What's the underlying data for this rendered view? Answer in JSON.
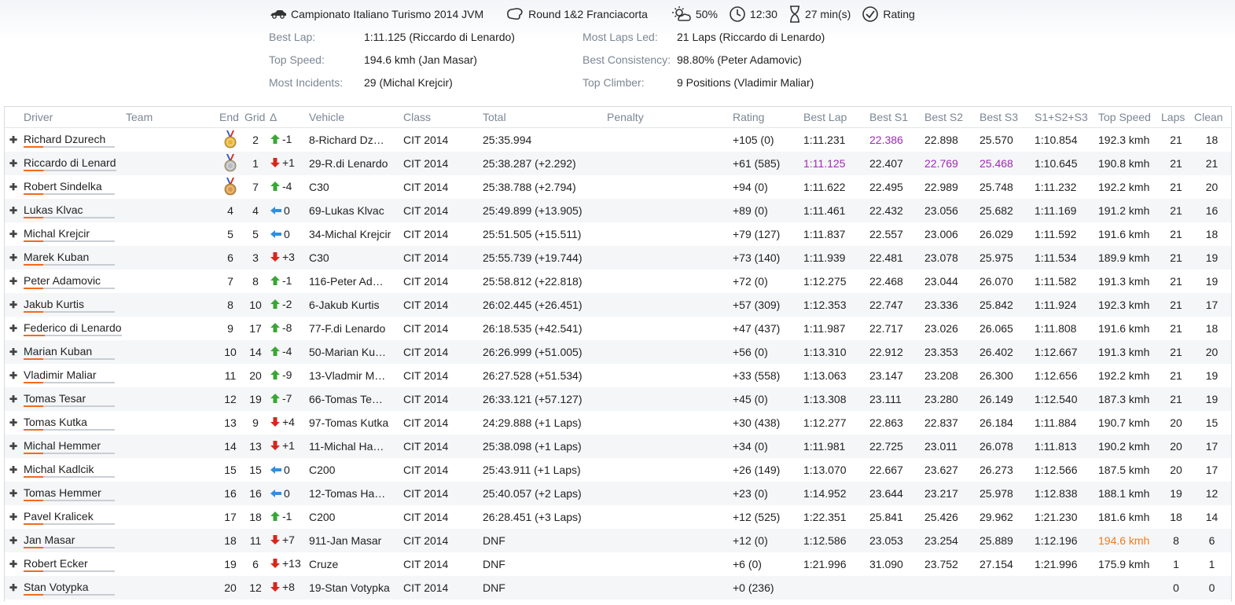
{
  "session": {
    "championship": "Campionato Italiano Turismo 2014 JVM",
    "round": "Round 1&2 Franciacorta",
    "weather": "50%",
    "time": "12:30",
    "duration": "27 min(s)",
    "rating": "Rating"
  },
  "stats": {
    "best_lap_label": "Best Lap:",
    "best_lap": "1:11.125 (Riccardo di Lenardo)",
    "top_speed_label": "Top Speed:",
    "top_speed": "194.6 kmh (Jan Masar)",
    "most_incidents_label": "Most Incidents:",
    "most_incidents": "29 (Michal Krejcir)",
    "most_laps_led_label": "Most Laps Led:",
    "most_laps_led": "21 Laps (Riccardo di Lenardo)",
    "best_consistency_label": "Best Consistency:",
    "best_consistency": "98.80% (Peter Adamovic)",
    "top_climber_label": "Top Climber:",
    "top_climber": "9 Positions (Vladimir Maliar)"
  },
  "columns": [
    "Driver",
    "Team",
    "End",
    "Grid",
    "Δ",
    "Vehicle",
    "Class",
    "Total",
    "Penalty",
    "Rating",
    "Best Lap",
    "Best S1",
    "Best S2",
    "Best S3",
    "S1+S2+S3",
    "Top Speed",
    "Laps",
    "Clean"
  ],
  "colors": {
    "purple": "#a02ab5",
    "orange": "#f07a1a",
    "up": "#3aa635",
    "down": "#d9261c",
    "same": "#2f8fe0"
  },
  "rows": [
    {
      "driver": "Richard Dzurech",
      "team": "",
      "end": "1",
      "medal": "gold",
      "grid": "2",
      "dir": "up",
      "delta": "-1",
      "vehicle": "8-Richard Dz…",
      "class": "CIT 2014",
      "total": "25:35.994",
      "penalty": "",
      "rating": "+105 (0)",
      "best_lap": "1:11.231",
      "s1": "22.386",
      "s2": "22.898",
      "s3": "25.570",
      "sum": "1:10.854",
      "speed": "192.3 kmh",
      "laps": "21",
      "clean": "18",
      "hl": {
        "s1": "purple"
      }
    },
    {
      "driver": "Riccardo di Lenard",
      "team": "",
      "end": "2",
      "medal": "silver",
      "grid": "1",
      "dir": "down",
      "delta": "+1",
      "vehicle": "29-R.di Lenardo",
      "class": "CIT 2014",
      "total": "25:38.287 (+2.292)",
      "penalty": "",
      "rating": "+61 (585)",
      "best_lap": "1:11.125",
      "s1": "22.407",
      "s2": "22.769",
      "s3": "25.468",
      "sum": "1:10.645",
      "speed": "190.8 kmh",
      "laps": "21",
      "clean": "21",
      "hl": {
        "best_lap": "purple",
        "s2": "purple",
        "s3": "purple"
      }
    },
    {
      "driver": "Robert Sindelka",
      "team": "",
      "end": "3",
      "medal": "bronze",
      "grid": "7",
      "dir": "up",
      "delta": "-4",
      "vehicle": "C30",
      "class": "CIT 2014",
      "total": "25:38.788 (+2.794)",
      "penalty": "",
      "rating": "+94 (0)",
      "best_lap": "1:11.622",
      "s1": "22.495",
      "s2": "22.989",
      "s3": "25.748",
      "sum": "1:11.232",
      "speed": "192.2 kmh",
      "laps": "21",
      "clean": "20",
      "hl": {}
    },
    {
      "driver": "Lukas Klvac",
      "team": "",
      "end": "4",
      "medal": "",
      "grid": "4",
      "dir": "same",
      "delta": "0",
      "vehicle": "69-Lukas Klvac",
      "class": "CIT 2014",
      "total": "25:49.899 (+13.905)",
      "penalty": "",
      "rating": "+89 (0)",
      "best_lap": "1:11.461",
      "s1": "22.432",
      "s2": "23.056",
      "s3": "25.682",
      "sum": "1:11.169",
      "speed": "191.2 kmh",
      "laps": "21",
      "clean": "16",
      "hl": {}
    },
    {
      "driver": "Michal Krejcir",
      "team": "",
      "end": "5",
      "medal": "",
      "grid": "5",
      "dir": "same",
      "delta": "0",
      "vehicle": "34-Michal Krejcir",
      "class": "CIT 2014",
      "total": "25:51.505 (+15.511)",
      "penalty": "",
      "rating": "+79 (127)",
      "best_lap": "1:11.837",
      "s1": "22.557",
      "s2": "23.006",
      "s3": "26.029",
      "sum": "1:11.592",
      "speed": "191.6 kmh",
      "laps": "21",
      "clean": "18",
      "hl": {}
    },
    {
      "driver": "Marek Kuban",
      "team": "",
      "end": "6",
      "medal": "",
      "grid": "3",
      "dir": "down",
      "delta": "+3",
      "vehicle": "C30",
      "class": "CIT 2014",
      "total": "25:55.739 (+19.744)",
      "penalty": "",
      "rating": "+73 (140)",
      "best_lap": "1:11.939",
      "s1": "22.481",
      "s2": "23.078",
      "s3": "25.975",
      "sum": "1:11.534",
      "speed": "189.9 kmh",
      "laps": "21",
      "clean": "19",
      "hl": {}
    },
    {
      "driver": "Peter Adamovic",
      "team": "",
      "end": "7",
      "medal": "",
      "grid": "8",
      "dir": "up",
      "delta": "-1",
      "vehicle": "116-Peter Ad…",
      "class": "CIT 2014",
      "total": "25:58.812 (+22.818)",
      "penalty": "",
      "rating": "+72 (0)",
      "best_lap": "1:12.275",
      "s1": "22.468",
      "s2": "23.044",
      "s3": "26.070",
      "sum": "1:11.582",
      "speed": "191.3 kmh",
      "laps": "21",
      "clean": "19",
      "hl": {}
    },
    {
      "driver": "Jakub Kurtis",
      "team": "",
      "end": "8",
      "medal": "",
      "grid": "10",
      "dir": "up",
      "delta": "-2",
      "vehicle": "6-Jakub Kurtis",
      "class": "CIT 2014",
      "total": "26:02.445 (+26.451)",
      "penalty": "",
      "rating": "+57 (309)",
      "best_lap": "1:12.353",
      "s1": "22.747",
      "s2": "23.336",
      "s3": "25.842",
      "sum": "1:11.924",
      "speed": "192.3 kmh",
      "laps": "21",
      "clean": "17",
      "hl": {}
    },
    {
      "driver": "Federico di Lenardo",
      "team": "",
      "end": "9",
      "medal": "",
      "grid": "17",
      "dir": "up",
      "delta": "-8",
      "vehicle": "77-F.di Lenardo",
      "class": "CIT 2014",
      "total": "26:18.535 (+42.541)",
      "penalty": "",
      "rating": "+47 (437)",
      "best_lap": "1:11.987",
      "s1": "22.717",
      "s2": "23.026",
      "s3": "26.065",
      "sum": "1:11.808",
      "speed": "191.6 kmh",
      "laps": "21",
      "clean": "18",
      "hl": {}
    },
    {
      "driver": "Marian Kuban",
      "team": "",
      "end": "10",
      "medal": "",
      "grid": "14",
      "dir": "up",
      "delta": "-4",
      "vehicle": "50-Marian Ku…",
      "class": "CIT 2014",
      "total": "26:26.999 (+51.005)",
      "penalty": "",
      "rating": "+56 (0)",
      "best_lap": "1:13.310",
      "s1": "22.912",
      "s2": "23.353",
      "s3": "26.402",
      "sum": "1:12.667",
      "speed": "191.3 kmh",
      "laps": "21",
      "clean": "20",
      "hl": {}
    },
    {
      "driver": "Vladimir Maliar",
      "team": "",
      "end": "11",
      "medal": "",
      "grid": "20",
      "dir": "up",
      "delta": "-9",
      "vehicle": "13-Vladmir M…",
      "class": "CIT 2014",
      "total": "26:27.528 (+51.534)",
      "penalty": "",
      "rating": "+33 (558)",
      "best_lap": "1:13.063",
      "s1": "23.147",
      "s2": "23.208",
      "s3": "26.300",
      "sum": "1:12.656",
      "speed": "192.2 kmh",
      "laps": "21",
      "clean": "19",
      "hl": {}
    },
    {
      "driver": "Tomas Tesar",
      "team": "",
      "end": "12",
      "medal": "",
      "grid": "19",
      "dir": "up",
      "delta": "-7",
      "vehicle": "66-Tomas Te…",
      "class": "CIT 2014",
      "total": "26:33.121 (+57.127)",
      "penalty": "",
      "rating": "+45 (0)",
      "best_lap": "1:13.308",
      "s1": "23.111",
      "s2": "23.280",
      "s3": "26.149",
      "sum": "1:12.540",
      "speed": "187.3 kmh",
      "laps": "21",
      "clean": "19",
      "hl": {}
    },
    {
      "driver": "Tomas Kutka",
      "team": "",
      "end": "13",
      "medal": "",
      "grid": "9",
      "dir": "down",
      "delta": "+4",
      "vehicle": "97-Tomas Kutka",
      "class": "CIT 2014",
      "total": "24:29.888 (+1 Laps)",
      "penalty": "",
      "rating": "+30 (438)",
      "best_lap": "1:12.277",
      "s1": "22.863",
      "s2": "22.837",
      "s3": "26.184",
      "sum": "1:11.884",
      "speed": "190.7 kmh",
      "laps": "20",
      "clean": "15",
      "hl": {}
    },
    {
      "driver": "Michal Hemmer",
      "team": "",
      "end": "14",
      "medal": "",
      "grid": "13",
      "dir": "down",
      "delta": "+1",
      "vehicle": "11-Michal Ha…",
      "class": "CIT 2014",
      "total": "25:38.098 (+1 Laps)",
      "penalty": "",
      "rating": "+34 (0)",
      "best_lap": "1:11.981",
      "s1": "22.725",
      "s2": "23.011",
      "s3": "26.078",
      "sum": "1:11.813",
      "speed": "190.2 kmh",
      "laps": "20",
      "clean": "17",
      "hl": {}
    },
    {
      "driver": "Michal Kadlcik",
      "team": "",
      "end": "15",
      "medal": "",
      "grid": "15",
      "dir": "same",
      "delta": "0",
      "vehicle": "C200",
      "class": "CIT 2014",
      "total": "25:43.911 (+1 Laps)",
      "penalty": "",
      "rating": "+26 (149)",
      "best_lap": "1:13.070",
      "s1": "22.667",
      "s2": "23.627",
      "s3": "26.273",
      "sum": "1:12.566",
      "speed": "187.5 kmh",
      "laps": "20",
      "clean": "17",
      "hl": {}
    },
    {
      "driver": "Tomas Hemmer",
      "team": "",
      "end": "16",
      "medal": "",
      "grid": "16",
      "dir": "same",
      "delta": "0",
      "vehicle": "12-Tomas Ha…",
      "class": "CIT 2014",
      "total": "25:40.057 (+2 Laps)",
      "penalty": "",
      "rating": "+23 (0)",
      "best_lap": "1:14.952",
      "s1": "23.644",
      "s2": "23.217",
      "s3": "25.978",
      "sum": "1:12.838",
      "speed": "188.1 kmh",
      "laps": "19",
      "clean": "12",
      "hl": {}
    },
    {
      "driver": "Pavel Kralicek",
      "team": "",
      "end": "17",
      "medal": "",
      "grid": "18",
      "dir": "up",
      "delta": "-1",
      "vehicle": "C200",
      "class": "CIT 2014",
      "total": "26:28.451 (+3 Laps)",
      "penalty": "",
      "rating": "+12 (525)",
      "best_lap": "1:22.351",
      "s1": "25.841",
      "s2": "25.426",
      "s3": "29.962",
      "sum": "1:21.230",
      "speed": "181.6 kmh",
      "laps": "18",
      "clean": "14",
      "hl": {}
    },
    {
      "driver": "Jan Masar",
      "team": "",
      "end": "18",
      "medal": "",
      "grid": "11",
      "dir": "down",
      "delta": "+7",
      "vehicle": "911-Jan Masar",
      "class": "CIT 2014",
      "total": "DNF",
      "penalty": "",
      "rating": "+12 (0)",
      "best_lap": "1:12.586",
      "s1": "23.053",
      "s2": "23.254",
      "s3": "25.889",
      "sum": "1:12.196",
      "speed": "194.6 kmh",
      "laps": "8",
      "clean": "6",
      "hl": {
        "speed": "orange"
      }
    },
    {
      "driver": "Robert Ecker",
      "team": "",
      "end": "19",
      "medal": "",
      "grid": "6",
      "dir": "down",
      "delta": "+13",
      "vehicle": "Cruze",
      "class": "CIT 2014",
      "total": "DNF",
      "penalty": "",
      "rating": "+6 (0)",
      "best_lap": "1:21.996",
      "s1": "31.090",
      "s2": "23.752",
      "s3": "27.154",
      "sum": "1:21.996",
      "speed": "175.9 kmh",
      "laps": "1",
      "clean": "1",
      "hl": {}
    },
    {
      "driver": "Stan Votypka",
      "team": "",
      "end": "20",
      "medal": "",
      "grid": "12",
      "dir": "down",
      "delta": "+8",
      "vehicle": "19-Stan Votypka",
      "class": "CIT 2014",
      "total": "DNF",
      "penalty": "",
      "rating": "+0 (236)",
      "best_lap": "",
      "s1": "",
      "s2": "",
      "s3": "",
      "sum": "",
      "speed": "",
      "laps": "0",
      "clean": "0",
      "hl": {}
    }
  ]
}
